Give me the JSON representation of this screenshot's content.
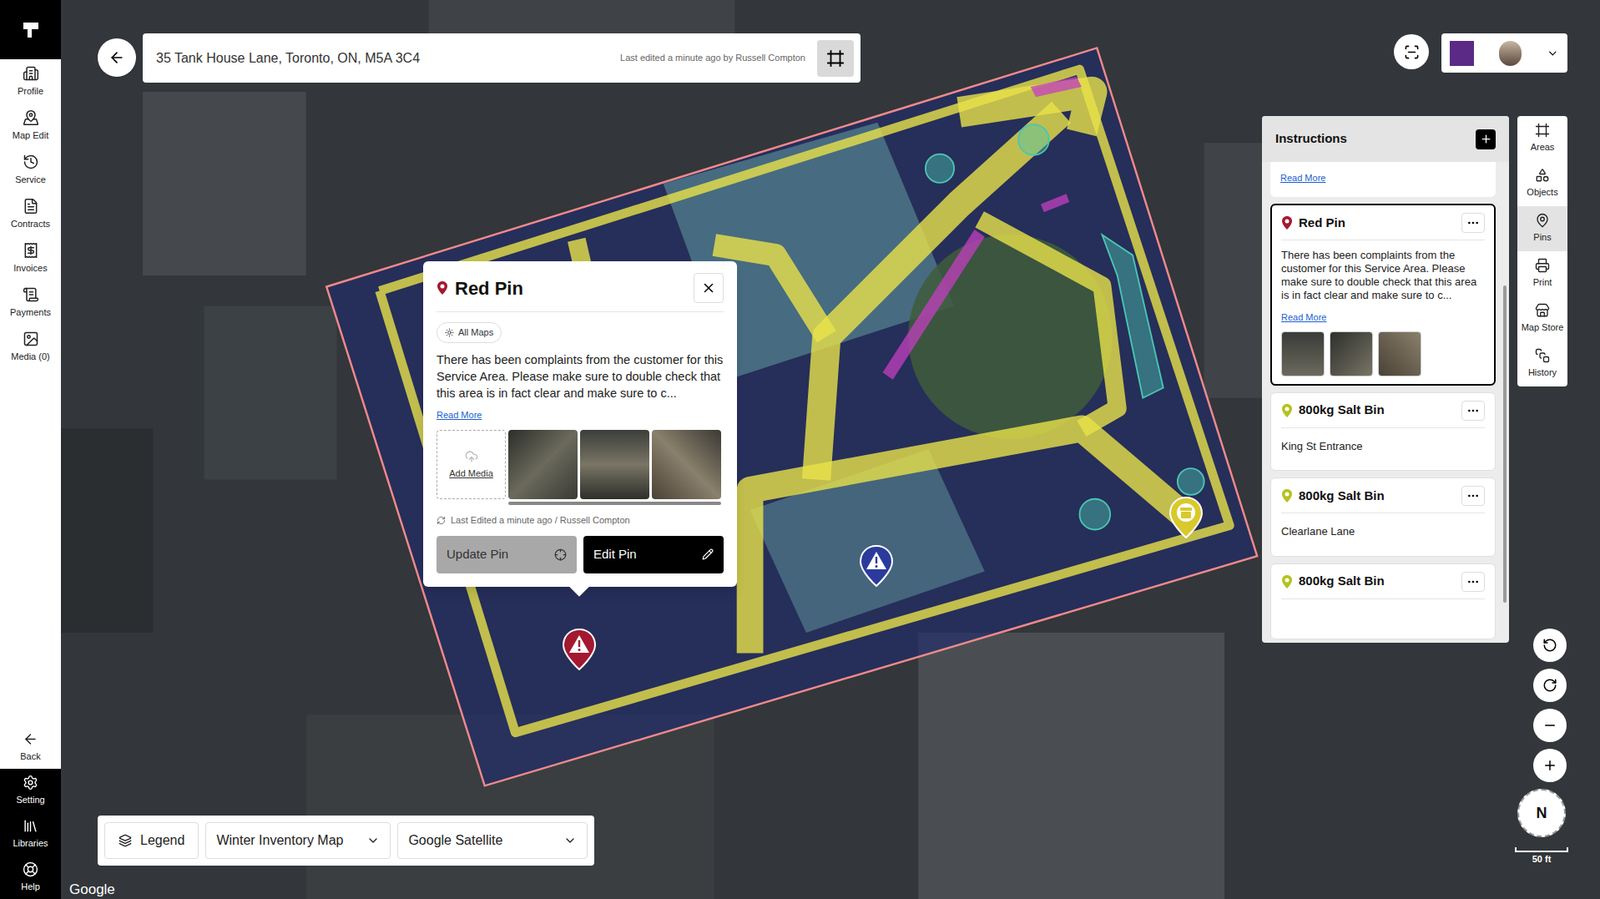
{
  "sidebar": {
    "items": [
      {
        "label": "Profile"
      },
      {
        "label": "Map Edit"
      },
      {
        "label": "Service"
      },
      {
        "label": "Contracts"
      },
      {
        "label": "Invoices"
      },
      {
        "label": "Payments"
      },
      {
        "label": "Media (0)"
      }
    ],
    "footer": [
      {
        "label": "Back"
      },
      {
        "label": "Setting"
      },
      {
        "label": "Libraries"
      },
      {
        "label": "Help"
      }
    ]
  },
  "header": {
    "address": "35 Tank House Lane, Toronto, ON, M5A 3C4",
    "edited": "Last edited a minute ago by Russell Compton"
  },
  "popup": {
    "title": "Red Pin",
    "tag": "All Maps",
    "body": "There has been complaints from the customer for this Service Area. Please make sure to double check that this area is in fact clear and make sure to c...",
    "read_more": "Read More",
    "add_media": "Add Media",
    "edited": "Last Edited a minute ago / Russell Compton",
    "update_button": "Update Pin",
    "edit_button": "Edit Pin"
  },
  "instructions": {
    "title": "Instructions",
    "cards": [
      {
        "kind": "partial",
        "read_more": "Read More",
        "selected": false
      },
      {
        "kind": "note",
        "title": "Red Pin",
        "body": "There has been complaints from the customer for this Service Area. Please make sure to double check that this area is in fact clear and make sure to c...",
        "read_more": "Read More",
        "color": "#a3192f",
        "selected": true
      },
      {
        "kind": "item",
        "title": "800kg Salt Bin",
        "subtitle": "King St Entrance",
        "color": "#b5c21f",
        "selected": false
      },
      {
        "kind": "item",
        "title": "800kg Salt Bin",
        "subtitle": "Clearlane Lane",
        "color": "#b5c21f",
        "selected": false
      },
      {
        "kind": "item",
        "title": "800kg Salt Bin",
        "subtitle": "",
        "color": "#b5c21f",
        "selected": false
      }
    ]
  },
  "toolbar": [
    {
      "label": "Areas",
      "selected": false
    },
    {
      "label": "Objects",
      "selected": false
    },
    {
      "label": "Pins",
      "selected": true
    },
    {
      "label": "Print",
      "selected": false
    },
    {
      "label": "Map Store",
      "selected": false
    },
    {
      "label": "History",
      "selected": false
    }
  ],
  "bottom_bar": {
    "legend": "Legend",
    "map": "Winter Inventory Map",
    "layer": "Google Satellite"
  },
  "map": {
    "attribution": "Google",
    "scale": "50 ft",
    "compass": "N",
    "pins": [
      {
        "kind": "warning",
        "color": "#a3192f"
      },
      {
        "kind": "warning",
        "color": "#2b3b9c"
      },
      {
        "kind": "bin",
        "color": "#d9c92b"
      }
    ]
  }
}
